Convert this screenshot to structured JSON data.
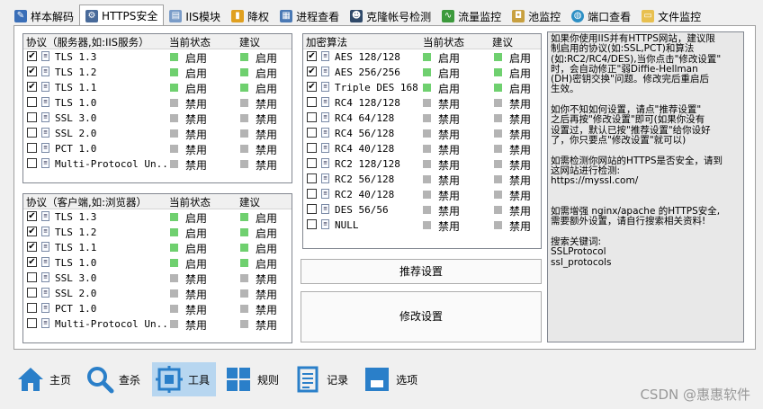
{
  "tabs": [
    {
      "label": "样本解码",
      "icon": "wand-icon",
      "color": "#3a6fb8"
    },
    {
      "label": "HTTPS安全",
      "icon": "shield-gear-icon",
      "color": "#486a9a"
    },
    {
      "label": "IIS模块",
      "icon": "module-icon",
      "color": "#7a9cc8"
    },
    {
      "label": "降权",
      "icon": "phone-icon",
      "color": "#e0a020"
    },
    {
      "label": "进程查看",
      "icon": "window-list-icon",
      "color": "#4a79b5"
    },
    {
      "label": "克隆帐号检测",
      "icon": "user-clone-icon",
      "color": "#304a6a"
    },
    {
      "label": "流量监控",
      "icon": "chart-icon",
      "color": "#3c9a3c"
    },
    {
      "label": "池监控",
      "icon": "pool-icon",
      "color": "#c8a040"
    },
    {
      "label": "端口查看",
      "icon": "globe-icon",
      "color": "#2d8fc4"
    },
    {
      "label": "文件监控",
      "icon": "folder-icon",
      "color": "#e8c050"
    }
  ],
  "server_protocols": {
    "headers": [
      "协议（服务器,如:IIS服务）",
      "当前状态",
      "建议"
    ],
    "rows": [
      {
        "name": "TLS 1.3",
        "checked": true,
        "status": "启用",
        "advice": "启用"
      },
      {
        "name": "TLS 1.2",
        "checked": true,
        "status": "启用",
        "advice": "启用"
      },
      {
        "name": "TLS 1.1",
        "checked": true,
        "status": "启用",
        "advice": "启用"
      },
      {
        "name": "TLS 1.0",
        "checked": false,
        "status": "禁用",
        "advice": "禁用"
      },
      {
        "name": "SSL 3.0",
        "checked": false,
        "status": "禁用",
        "advice": "禁用"
      },
      {
        "name": "SSL 2.0",
        "checked": false,
        "status": "禁用",
        "advice": "禁用"
      },
      {
        "name": "PCT 1.0",
        "checked": false,
        "status": "禁用",
        "advice": "禁用"
      },
      {
        "name": "Multi-Protocol Un...",
        "checked": false,
        "status": "禁用",
        "advice": "禁用"
      }
    ]
  },
  "client_protocols": {
    "headers": [
      "协议（客户端,如:浏览器）",
      "当前状态",
      "建议"
    ],
    "rows": [
      {
        "name": "TLS 1.3",
        "checked": true,
        "status": "启用",
        "advice": "启用"
      },
      {
        "name": "TLS 1.2",
        "checked": true,
        "status": "启用",
        "advice": "启用"
      },
      {
        "name": "TLS 1.1",
        "checked": true,
        "status": "启用",
        "advice": "启用"
      },
      {
        "name": "TLS 1.0",
        "checked": true,
        "status": "启用",
        "advice": "启用"
      },
      {
        "name": "SSL 3.0",
        "checked": false,
        "status": "禁用",
        "advice": "禁用"
      },
      {
        "name": "SSL 2.0",
        "checked": false,
        "status": "禁用",
        "advice": "禁用"
      },
      {
        "name": "PCT 1.0",
        "checked": false,
        "status": "禁用",
        "advice": "禁用"
      },
      {
        "name": "Multi-Protocol Un...",
        "checked": false,
        "status": "禁用",
        "advice": "禁用"
      }
    ]
  },
  "ciphers": {
    "headers": [
      "加密算法",
      "当前状态",
      "建议"
    ],
    "rows": [
      {
        "name": "AES 128/128",
        "checked": true,
        "status": "启用",
        "advice": "启用"
      },
      {
        "name": "AES 256/256",
        "checked": true,
        "status": "启用",
        "advice": "启用"
      },
      {
        "name": "Triple DES 168",
        "checked": true,
        "status": "启用",
        "advice": "启用"
      },
      {
        "name": "RC4 128/128",
        "checked": false,
        "status": "禁用",
        "advice": "禁用"
      },
      {
        "name": "RC4 64/128",
        "checked": false,
        "status": "禁用",
        "advice": "禁用"
      },
      {
        "name": "RC4 56/128",
        "checked": false,
        "status": "禁用",
        "advice": "禁用"
      },
      {
        "name": "RC4 40/128",
        "checked": false,
        "status": "禁用",
        "advice": "禁用"
      },
      {
        "name": "RC2 128/128",
        "checked": false,
        "status": "禁用",
        "advice": "禁用"
      },
      {
        "name": "RC2 56/128",
        "checked": false,
        "status": "禁用",
        "advice": "禁用"
      },
      {
        "name": "RC2 40/128",
        "checked": false,
        "status": "禁用",
        "advice": "禁用"
      },
      {
        "name": "DES 56/56",
        "checked": false,
        "status": "禁用",
        "advice": "禁用"
      },
      {
        "name": "NULL",
        "checked": false,
        "status": "禁用",
        "advice": "禁用"
      }
    ]
  },
  "buttons": {
    "recommend": "推荐设置",
    "modify": "修改设置"
  },
  "info_text": "如果你使用IIS并有HTTPS网站，建议限\n制启用的协议(如:SSL,PCT)和算法\n(如:RC2/RC4/DES),当你点击\"修改设置\"\n时，会自动修正\"弱Diffie-Hellman\n(DH)密钥交换\"问题。修改完后重启后\n生效。\n\n如你不知如何设置，请点\"推荐设置\"\n之后再按\"修改设置\"即可(如果你没有\n设置过，默认已按\"推荐设置\"给你设好\n了，你只要点\"修改设置\"就可以)\n\n如需检测你网站的HTTPS是否安全，请到\n这网站进行检测:\nhttps://myssl.com/\n\n\n如需增强 nginx/apache 的HTTPS安全,\n需要额外设置，请自行搜索相关资料!\n\n搜索关键词:\nSSLProtocol\nssl_protocols",
  "bottom_nav": [
    {
      "label": "主页",
      "icon": "home-icon",
      "active": false
    },
    {
      "label": "查杀",
      "icon": "search-icon",
      "active": false
    },
    {
      "label": "工具",
      "icon": "tools-icon",
      "active": true
    },
    {
      "label": "规则",
      "icon": "rules-grid-icon",
      "active": false
    },
    {
      "label": "记录",
      "icon": "log-icon",
      "active": false
    },
    {
      "label": "选项",
      "icon": "options-icon",
      "active": false
    }
  ],
  "watermark": "CSDN @惠惠软件",
  "colors": {
    "enabled": "#6fd06f",
    "disabled": "#b4b4b4",
    "accent": "#2a7fc9"
  }
}
